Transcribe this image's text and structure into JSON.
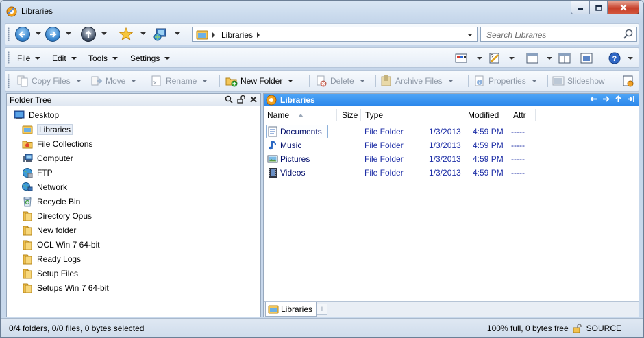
{
  "window": {
    "title": "Libraries"
  },
  "nav": {
    "address": "Libraries",
    "search_placeholder": "Search Libraries"
  },
  "menu": [
    "File",
    "Edit",
    "Tools",
    "Settings"
  ],
  "actions": {
    "copy_files": "Copy Files",
    "move": "Move",
    "rename": "Rename",
    "new_folder": "New Folder",
    "delete": "Delete",
    "archive_files": "Archive Files",
    "properties": "Properties",
    "slideshow": "Slideshow"
  },
  "tree": {
    "header": "Folder Tree",
    "items": [
      {
        "label": "Desktop",
        "icon": "desktop-icon"
      },
      {
        "label": "Libraries",
        "icon": "libraries-icon"
      },
      {
        "label": "File Collections",
        "icon": "collections-icon"
      },
      {
        "label": "Computer",
        "icon": "computer-icon"
      },
      {
        "label": "FTP",
        "icon": "ftp-icon"
      },
      {
        "label": "Network",
        "icon": "network-icon"
      },
      {
        "label": "Recycle Bin",
        "icon": "recycle-bin-icon"
      },
      {
        "label": "Directory Opus",
        "icon": "folder-icon"
      },
      {
        "label": "New folder",
        "icon": "folder-icon"
      },
      {
        "label": "OCL Win 7 64-bit",
        "icon": "folder-icon"
      },
      {
        "label": "Ready Logs",
        "icon": "folder-icon"
      },
      {
        "label": "Setup Files",
        "icon": "folder-icon"
      },
      {
        "label": "Setups Win 7 64-bit",
        "icon": "folder-icon"
      }
    ]
  },
  "lister": {
    "title": "Libraries",
    "columns": {
      "name": "Name",
      "size": "Size",
      "type": "Type",
      "modified": "Modified",
      "attr": "Attr"
    },
    "rows": [
      {
        "name": "Documents",
        "icon": "documents-icon",
        "type": "File Folder",
        "date": "1/3/2013",
        "time": "4:59 PM",
        "attr": "-----"
      },
      {
        "name": "Music",
        "icon": "music-icon",
        "type": "File Folder",
        "date": "1/3/2013",
        "time": "4:59 PM",
        "attr": "-----"
      },
      {
        "name": "Pictures",
        "icon": "pictures-icon",
        "type": "File Folder",
        "date": "1/3/2013",
        "time": "4:59 PM",
        "attr": "-----"
      },
      {
        "name": "Videos",
        "icon": "videos-icon",
        "type": "File Folder",
        "date": "1/3/2013",
        "time": "4:59 PM",
        "attr": "-----"
      }
    ],
    "tab_label": "Libraries",
    "tab_add": "+"
  },
  "status": {
    "left": "0/4 folders, 0/0 files, 0 bytes selected",
    "right": "100% full, 0 bytes free",
    "source": "SOURCE"
  },
  "colors": {
    "title_bar_blue": "#2a86ea",
    "link_blue": "#1d2ea6"
  }
}
